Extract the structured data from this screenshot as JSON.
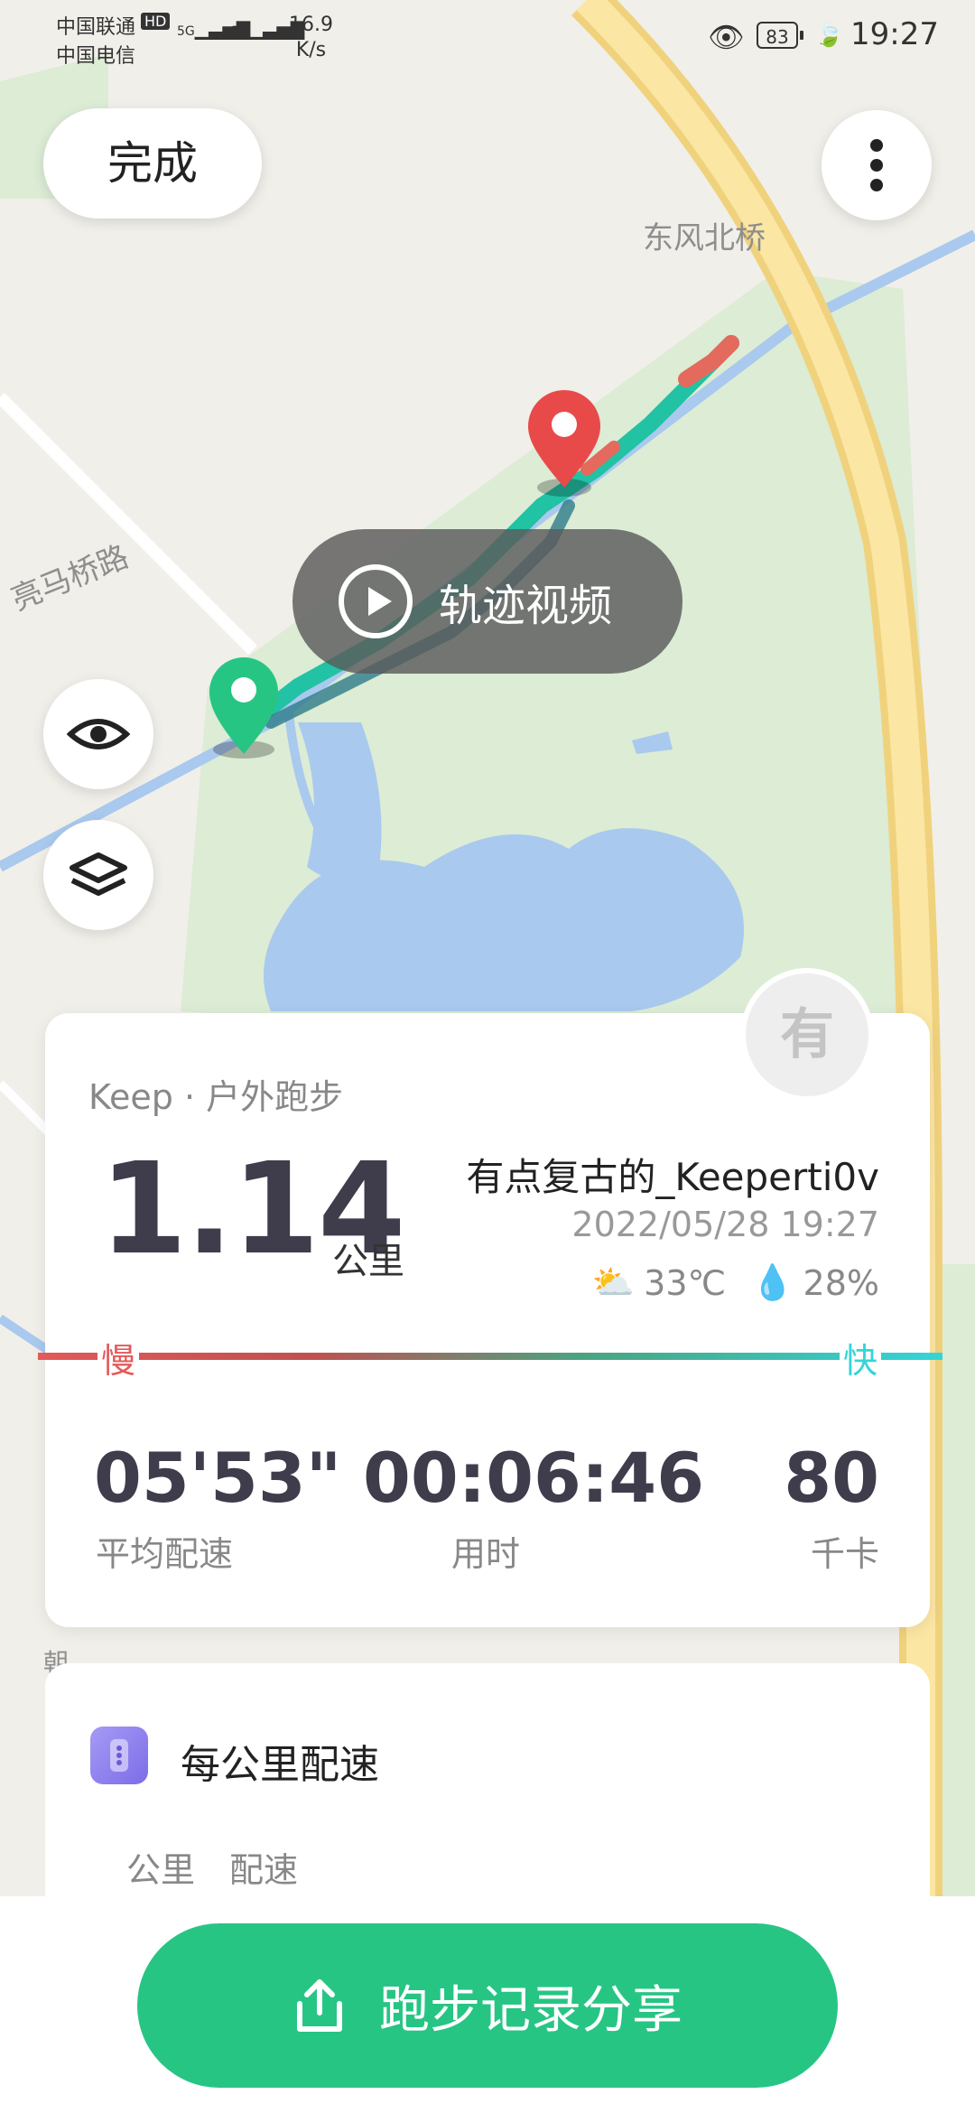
{
  "status_bar": {
    "carrier1": "中国联通",
    "hd": "HD",
    "carrier2": "中国电信",
    "sig1": "5G",
    "sig2": "2G",
    "speed_value": "16.9",
    "speed_unit": "K/s",
    "battery": "83",
    "time": "19:27"
  },
  "top": {
    "done_label": "完成",
    "menu_icon": "more-vertical-icon"
  },
  "map": {
    "label_bridge": "东风北桥",
    "label_road": "亮马桥路",
    "label_partial": "朝",
    "track_video_label": "轨迹视频",
    "start_color": "#27c584",
    "end_color": "#e84a4a"
  },
  "map_controls": {
    "visibility_icon": "eye-icon",
    "layers_icon": "layers-icon"
  },
  "stats": {
    "source": "Keep · 户外跑步",
    "distance": "1.14",
    "distance_unit": "公里",
    "user_name": "有点复古的_Keeperti0v",
    "datetime": "2022/05/28 19:27",
    "temperature": "33℃",
    "humidity": "28%",
    "slow_label": "慢",
    "fast_label": "快",
    "avatar_text": "有",
    "metrics": [
      {
        "value": "05'53\"",
        "label": "平均配速"
      },
      {
        "value": "00:06:46",
        "label": "用时"
      },
      {
        "value": "80",
        "label": "千卡"
      }
    ]
  },
  "pace_card": {
    "title": "每公里配速",
    "col_km": "公里",
    "col_pace": "配速"
  },
  "share": {
    "label": "跑步记录分享",
    "color": "#27c584"
  }
}
